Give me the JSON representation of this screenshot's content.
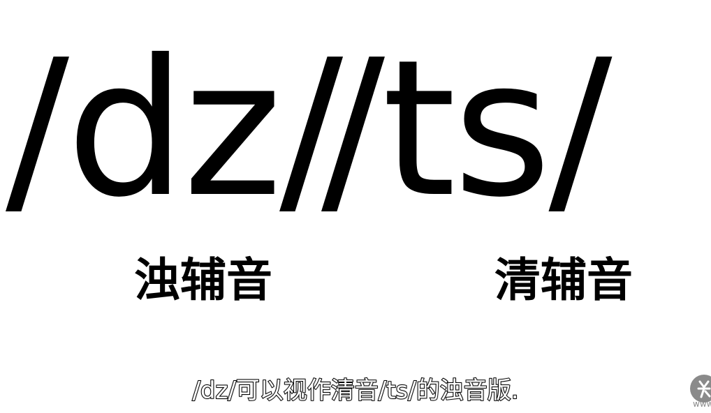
{
  "slide": {
    "left_ipa": "/dz/",
    "right_ipa": "/ts/",
    "left_label": "浊辅音",
    "right_label": "清辅音"
  },
  "subtitle": {
    "text": "/dz/可以视作清音/ts/的浊音版."
  },
  "watermark": {
    "icon": "channel-logo-icon",
    "text": "www"
  },
  "colors": {
    "background": "#ffffff",
    "text": "#000000",
    "subtitle_fill": "#ffffff",
    "subtitle_stroke": "#000000",
    "watermark": "#8a8a8a"
  }
}
